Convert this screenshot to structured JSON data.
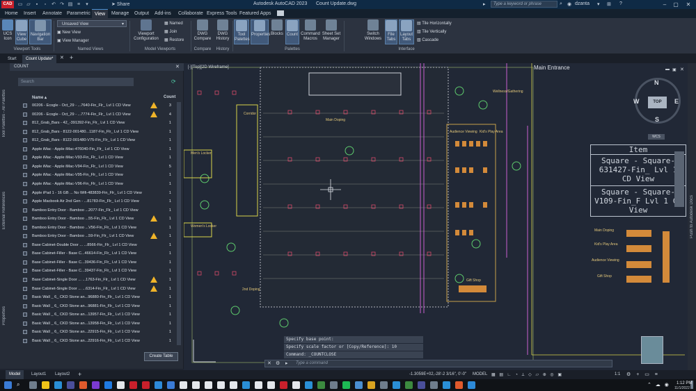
{
  "titlebar": {
    "logo": "CAD",
    "share_label": "Share",
    "title": "Autodesk AutoCAD 2023",
    "filename": "Count Update.dwg",
    "search_placeholder": "Type a keyword or phrase",
    "user": "dzanta"
  },
  "menu_tabs": [
    "Home",
    "Insert",
    "Annotate",
    "Parametric",
    "View",
    "Manage",
    "Output",
    "Add-ins",
    "Collaborate",
    "Express Tools",
    "Featured Apps"
  ],
  "active_menu_tab": "View",
  "ribbon": {
    "ucs_icon": "UCS Icon",
    "view_cube": "View Cube",
    "navigation_bar": "Navigation Bar",
    "viewport_tools": "Viewport Tools",
    "unsaved_view": "Unsaved View",
    "new_view": "New View",
    "view_manager": "View Manager",
    "named_views": "Named Views",
    "viewport_configuration": "Viewport Configuration",
    "named": "Named",
    "join": "Join",
    "restore": "Restore",
    "model_viewports": "Model Viewports",
    "dwg_compare": "DWG Compare",
    "compare": "Compare",
    "dwg_history": "DWG History",
    "history": "History",
    "tool_palettes": "Tool Palettes",
    "properties": "Properties",
    "blocks": "Blocks",
    "count": "Count",
    "command_macros": "Command Macros",
    "sheet_set_manager": "Sheet Set Manager",
    "palettes": "Palettes",
    "switch_windows": "Switch Windows",
    "file_tabs": "File Tabs",
    "layout_tabs": "Layout Tabs",
    "tile_horizontally": "Tile Horizontally",
    "tile_vertically": "Tile Vertically",
    "cascade": "Cascade",
    "interface": "Interface"
  },
  "doc_tabs": [
    "Start",
    "Count Update*"
  ],
  "count_panel": {
    "header": "COUNT",
    "search_placeholder": "Search",
    "col_name": "Name",
    "col_count": "Count",
    "rows": [
      {
        "name": "00206 - Ecogle - Oct_29 - ...7640-Fin_Flr_ Lvl 1 CD View",
        "count": "3",
        "warn": true
      },
      {
        "name": "00206 - Ecogle - Oct_29 - ...7774-Fin_Flr_ Lvl 1 CD View",
        "count": "4",
        "warn": true
      },
      {
        "name": "812_Grab_Bars - 42_-391392-Fin_Flr_ Lvl 1 CD View",
        "count": "1",
        "warn": false
      },
      {
        "name": "812_Grab_Bars - 8122-001480...1187-Fin_Flr_ Lvl 1 CD View",
        "count": "1",
        "warn": false
      },
      {
        "name": "812_Grab_Bars - 8122-001480-V75-Fin_Flr_ Lvl 1 CD View",
        "count": "1",
        "warn": false
      },
      {
        "name": "Apple iMac - Apple iMac-476040-Fin_Flr_ Lvl 1 CD View",
        "count": "1",
        "warn": false
      },
      {
        "name": "Apple iMac - Apple iMac-V93-Fin_Flr_ Lvl 1 CD View",
        "count": "1",
        "warn": false
      },
      {
        "name": "Apple iMac - Apple iMac-V94-Fin_Flr_ Lvl 1 CD View",
        "count": "5",
        "warn": false
      },
      {
        "name": "Apple iMac - Apple iMac-V95-Fin_Flr_ Lvl 1 CD View",
        "count": "1",
        "warn": false
      },
      {
        "name": "Apple iMac - Apple iMac-V96-Fin_Flr_ Lvl 1 CD View",
        "count": "1",
        "warn": false
      },
      {
        "name": "Apple iPad 1 - 16 GB ... No Wifi-483839-Fin_Flr_ Lvl 1 CD View",
        "count": "1",
        "warn": false
      },
      {
        "name": "Apple Macbook Air 2nd Gen - ...81783-Fin_Flr_ Lvl 1 CD View",
        "count": "1",
        "warn": false
      },
      {
        "name": "Bamboo Entry Door - Bamboo ...2077-Fin_Flr_ Lvl 1 CD View",
        "count": "1",
        "warn": false
      },
      {
        "name": "Bamboo Entry Door - Bamboo ...55-Fin_Flr_ Lvl 1 CD View",
        "count": "1",
        "warn": true
      },
      {
        "name": "Bamboo Entry Door - Bamboo ...V56-Fin_Flr_ Lvl 1 CD View",
        "count": "1",
        "warn": false
      },
      {
        "name": "Bamboo Entry Door - Bamboo ...59-Fin_Flr_ Lvl 1 CD View",
        "count": "1",
        "warn": true
      },
      {
        "name": "Base Cabinet-Double Door ... ...8566-Fin_Flr_ Lvl 1 CD View",
        "count": "1",
        "warn": false
      },
      {
        "name": "Base Cabinet-Filler - Base C...46614-Fin_Flr_ Lvl 1 CD View",
        "count": "1",
        "warn": false
      },
      {
        "name": "Base Cabinet-Filler - Base C...39436-Fin_Flr_ Lvl 1 CD View",
        "count": "1",
        "warn": false
      },
      {
        "name": "Base Cabinet-Filler - Base C...39437-Fin_Flr_ Lvl 1 CD View",
        "count": "1",
        "warn": false
      },
      {
        "name": "Base Cabinet-Single Door ... ...1763-Fin_Flr_ Lvl 1 CD View",
        "count": "1",
        "warn": true
      },
      {
        "name": "Base Cabinet-Single Door ... ...6314-Fin_Flr_ Lvl 1 CD View",
        "count": "1",
        "warn": true
      },
      {
        "name": "Basic Wall _ 6_ CKD Stone an...96880-Fin_Flr_ Lvl 1 CD View",
        "count": "1",
        "warn": false
      },
      {
        "name": "Basic Wall _ 6_ CKD Stone an...96881-Fin_Flr_ Lvl 1 CD View",
        "count": "1",
        "warn": false
      },
      {
        "name": "Basic Wall _ 6_ CKD Stone an...13957-Fin_Flr_ Lvl 1 CD View",
        "count": "1",
        "warn": false
      },
      {
        "name": "Basic Wall _ 6_ CKD Stone an...13958-Fin_Flr_ Lvl 1 CD View",
        "count": "1",
        "warn": false
      },
      {
        "name": "Basic Wall _ 6_ CKD Stone an...22915-Fin_Flr_ Lvl 1 CD View",
        "count": "1",
        "warn": false
      },
      {
        "name": "Basic Wall _ 6_ CKD Stone an...22916-Fin_Flr_ Lvl 1 CD View",
        "count": "1",
        "warn": false
      }
    ],
    "create_table": "Create Table"
  },
  "side_palettes": [
    "Tool Palettes - All Palettes",
    "External References",
    "Properties"
  ],
  "right_dock": "Push to Autodesk Docs",
  "viewport_label": "[-][Top][2D Wireframe]",
  "viewcube": {
    "top": "TOP",
    "n": "N",
    "s": "S",
    "e": "E",
    "w": "W",
    "wcs": "WCS"
  },
  "drawing": {
    "main_entrance": "Main Entrance",
    "table_block": [
      "Item",
      "Square - Square-631427-Fin_ Lvl 1 CD View",
      "Square - Square-V109-Fin_F Lvl 1 CD View"
    ],
    "labels": [
      "Main Doping",
      "Gift Shop",
      "Kid's Play Area",
      "Audience Viewing",
      "Corridor",
      "Men's Locker",
      "Women's Locker",
      "2nd Doping",
      "Wellness/Gathering",
      "Kid's Play Area",
      "Audience Viewing",
      "Main Doping",
      "Gift Shop"
    ]
  },
  "command": {
    "lines": [
      "Specify base point:",
      "Specify scale factor or [Copy/Reference]: 10",
      "Command: _COUNTCLOSE"
    ],
    "placeholder": "Type a command"
  },
  "layout_tabs": [
    "Model",
    "Layout1",
    "Layout2"
  ],
  "status": {
    "coords": "-1.3059E+02,-28'-2 3/16\", 0'-0\"",
    "model": "MODEL",
    "scale": "1:1"
  },
  "taskbar": {
    "time": "1:12 PM",
    "date": "11/1/2022"
  },
  "colors": {
    "accent": "#4a8fd1",
    "warning": "#f0b429",
    "cad_red": "#c8202b"
  }
}
